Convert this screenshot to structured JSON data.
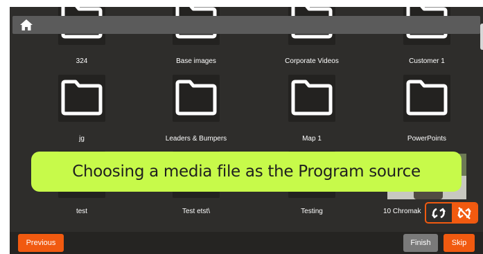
{
  "colors": {
    "accent": "#f15a10",
    "caption_bg": "#c7fa4a",
    "panel_bg": "#2e2d2b"
  },
  "nav": {
    "home_icon": "home-icon"
  },
  "folders": [
    {
      "label": "324"
    },
    {
      "label": "Base images"
    },
    {
      "label": "Corporate Videos"
    },
    {
      "label": "Customer 1"
    },
    {
      "label": "jg"
    },
    {
      "label": "Leaders & Bumpers"
    },
    {
      "label": "Map 1"
    },
    {
      "label": "PowerPoints"
    },
    {
      "label": "test"
    },
    {
      "label": "Test etst\\"
    },
    {
      "label": "Testing"
    }
  ],
  "media": [
    {
      "label": "10 Chromak"
    }
  ],
  "caption": {
    "text": "Choosing a media file as the Program source"
  },
  "swap": {
    "left_icon": "refresh-icon",
    "right_icon": "swap-disabled-icon"
  },
  "footer": {
    "previous_label": "Previous",
    "finish_label": "Finish",
    "skip_label": "Skip"
  }
}
